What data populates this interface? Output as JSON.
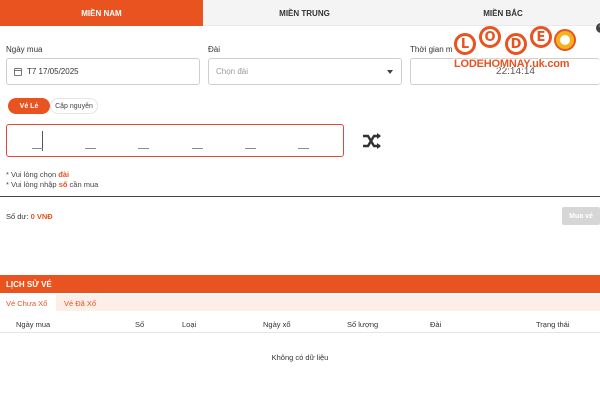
{
  "tabs": [
    "MIỀN NAM",
    "MIỀN TRUNG",
    "MIỀN BẮC"
  ],
  "form": {
    "date_label": "Ngày mua",
    "date_value": "T7 17/05/2025",
    "station_label": "Đài",
    "station_placeholder": "Chọn đài",
    "time_label": "Thời gian m",
    "time_value": "22:14:14"
  },
  "logo": {
    "balls": [
      "L",
      "O",
      "D",
      "E"
    ],
    "text": "LODEHOMNAY.uk.com"
  },
  "ticket_types": [
    "Vé Lẻ",
    "Cặp nguyên"
  ],
  "digits": [
    "_",
    "_",
    "_",
    "_",
    "_",
    "_"
  ],
  "notes": [
    {
      "pre": "* Vui lòng chọn ",
      "hl": "đài",
      "post": ""
    },
    {
      "pre": "* Vui lòng nhập ",
      "hl": "số",
      "post": " cần mua"
    }
  ],
  "balance": {
    "label": "Số dư: ",
    "amount": "0 VNĐ"
  },
  "buy_button": "Mua vé",
  "history": {
    "title": "LỊCH SỬ VÉ",
    "tabs": [
      "Vé Chưa Xổ",
      "Vé Đã Xổ"
    ],
    "columns": [
      "Ngày mua",
      "Số",
      "Loại",
      "Ngày xổ",
      "Số lượng",
      "Đài",
      "Trạng thái"
    ],
    "empty": "Không có dữ liệu"
  },
  "colors": {
    "accent": "#e8531f",
    "error_border": "#e04a3a"
  }
}
